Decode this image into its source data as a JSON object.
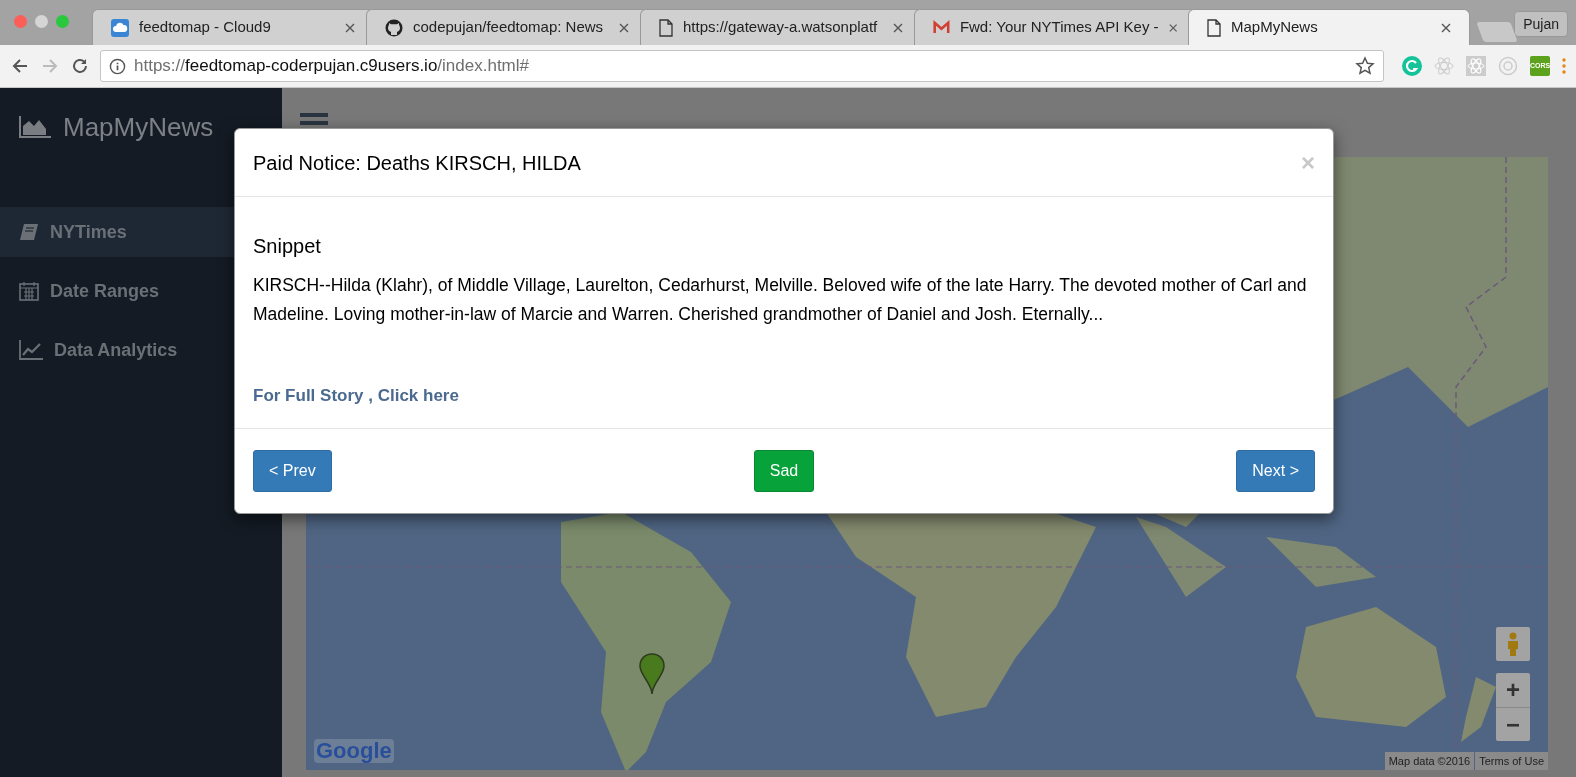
{
  "browser": {
    "tabs": [
      {
        "kind": "cloud",
        "title": "feedtomap - Cloud9",
        "selected": false
      },
      {
        "kind": "github",
        "title": "codepujan/feedtomap: News",
        "selected": false
      },
      {
        "kind": "page",
        "title": "https://gateway-a.watsonplatf",
        "selected": false
      },
      {
        "kind": "mail",
        "title": "Fwd: Your NYTimes API Key -",
        "selected": false
      },
      {
        "kind": "page",
        "title": "MapMyNews",
        "selected": true
      }
    ],
    "profile": "Pujan",
    "address": {
      "scheme": "https://",
      "host": "feedtomap-coderpujan.c9users.io",
      "path": "/index.html#"
    },
    "extensions": [
      {
        "kind": "grammar"
      },
      {
        "kind": "atom"
      },
      {
        "kind": "atom-box"
      },
      {
        "kind": "ring"
      },
      {
        "kind": "cors",
        "label": "CORS"
      }
    ]
  },
  "app": {
    "brand": "MapMyNews",
    "sidebar": {
      "items": [
        {
          "kind": "book",
          "label": "NYTimes",
          "selected": true
        },
        {
          "kind": "calendar",
          "label": "Date Ranges",
          "selected": false
        },
        {
          "kind": "chart",
          "label": "Data Analytics",
          "selected": false
        }
      ]
    },
    "map": {
      "google_logo": "Google",
      "attribution": "Map data ©2016",
      "terms": "Terms of Use",
      "zoom_in": "+",
      "zoom_out": "−"
    },
    "modal": {
      "title": "Paid Notice: Deaths KIRSCH, HILDA",
      "close": "×",
      "heading": "Snippet",
      "snippet": "KIRSCH--Hilda (Klahr), of Middle Village, Laurelton, Cedarhurst, Melville. Beloved wife of the late Harry. The devoted mother of Carl and Madeline. Loving mother-in-law of Marcie and Warren. Cherished grandmother of Daniel and Josh. Eternally...",
      "link": "For Full Story , Click here",
      "buttons": [
        {
          "kind": "primary",
          "label": "< Prev"
        },
        {
          "kind": "success",
          "label": "Sad"
        },
        {
          "kind": "primary",
          "label": "Next >"
        }
      ]
    }
  }
}
